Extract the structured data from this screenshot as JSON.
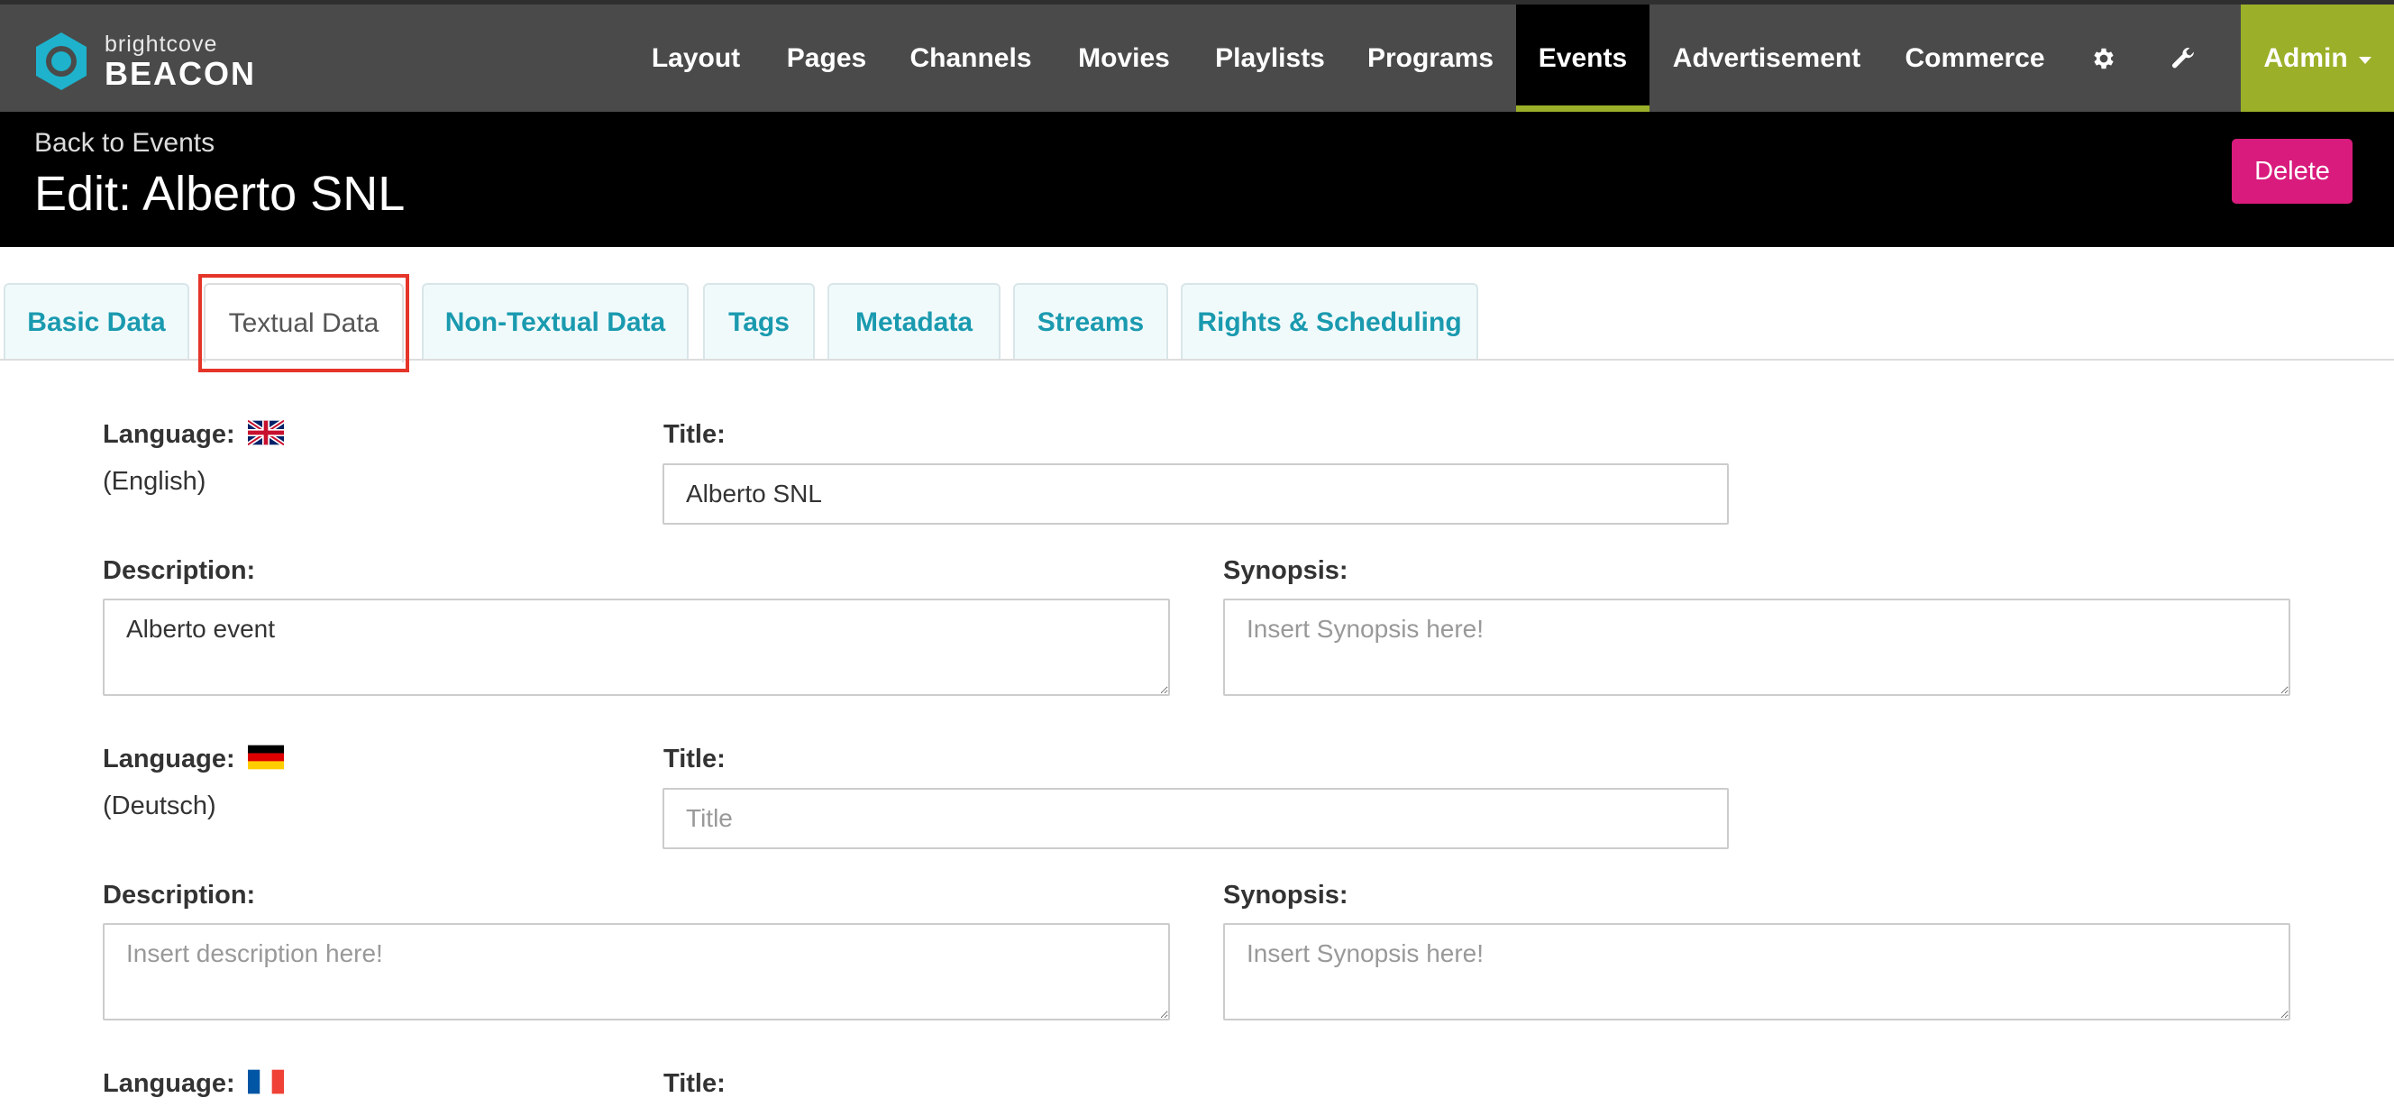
{
  "brand": {
    "name_small": "brightcove",
    "name_big": "BEACON",
    "logo_icon": "hexagon-logo-icon",
    "logo_color": "#1eb2cc"
  },
  "nav": {
    "items": [
      {
        "label": "Layout",
        "active": false
      },
      {
        "label": "Pages",
        "active": false
      },
      {
        "label": "Channels",
        "active": false
      },
      {
        "label": "Movies",
        "active": false
      },
      {
        "label": "Playlists",
        "active": false
      },
      {
        "label": "Programs",
        "active": false
      },
      {
        "label": "Events",
        "active": true
      },
      {
        "label": "Advertisement",
        "active": false
      },
      {
        "label": "Commerce",
        "active": false
      }
    ],
    "icons": [
      "gear-icon",
      "wrench-icon"
    ],
    "admin_label": "Admin",
    "active_accent": "#9bb028",
    "background": "#4a4a4a"
  },
  "header": {
    "back_link": "Back to Events",
    "title": "Edit: Alberto SNL",
    "delete_label": "Delete",
    "delete_color": "#d81b7d"
  },
  "tabs": [
    {
      "label": "Basic Data",
      "active": false
    },
    {
      "label": "Textual Data",
      "active": true
    },
    {
      "label": "Non-Textual Data",
      "active": false
    },
    {
      "label": "Tags",
      "active": false
    },
    {
      "label": "Metadata",
      "active": false
    },
    {
      "label": "Streams",
      "active": false
    },
    {
      "label": "Rights & Scheduling",
      "active": false
    }
  ],
  "form": {
    "language_label": "Language:",
    "title_label": "Title:",
    "description_label": "Description:",
    "synopsis_label": "Synopsis:",
    "languages": [
      {
        "flag": "uk-flag-icon",
        "name": "(English)",
        "title_value": "Alberto SNL",
        "title_placeholder": "Title",
        "description_value": "Alberto event",
        "description_placeholder": "Insert description here!",
        "synopsis_value": "",
        "synopsis_placeholder": "Insert Synopsis here!"
      },
      {
        "flag": "germany-flag-icon",
        "name": "(Deutsch)",
        "title_value": "",
        "title_placeholder": "Title",
        "description_value": "",
        "description_placeholder": "Insert description here!",
        "synopsis_value": "",
        "synopsis_placeholder": "Insert Synopsis here!"
      },
      {
        "flag": "france-flag-icon"
      }
    ]
  }
}
